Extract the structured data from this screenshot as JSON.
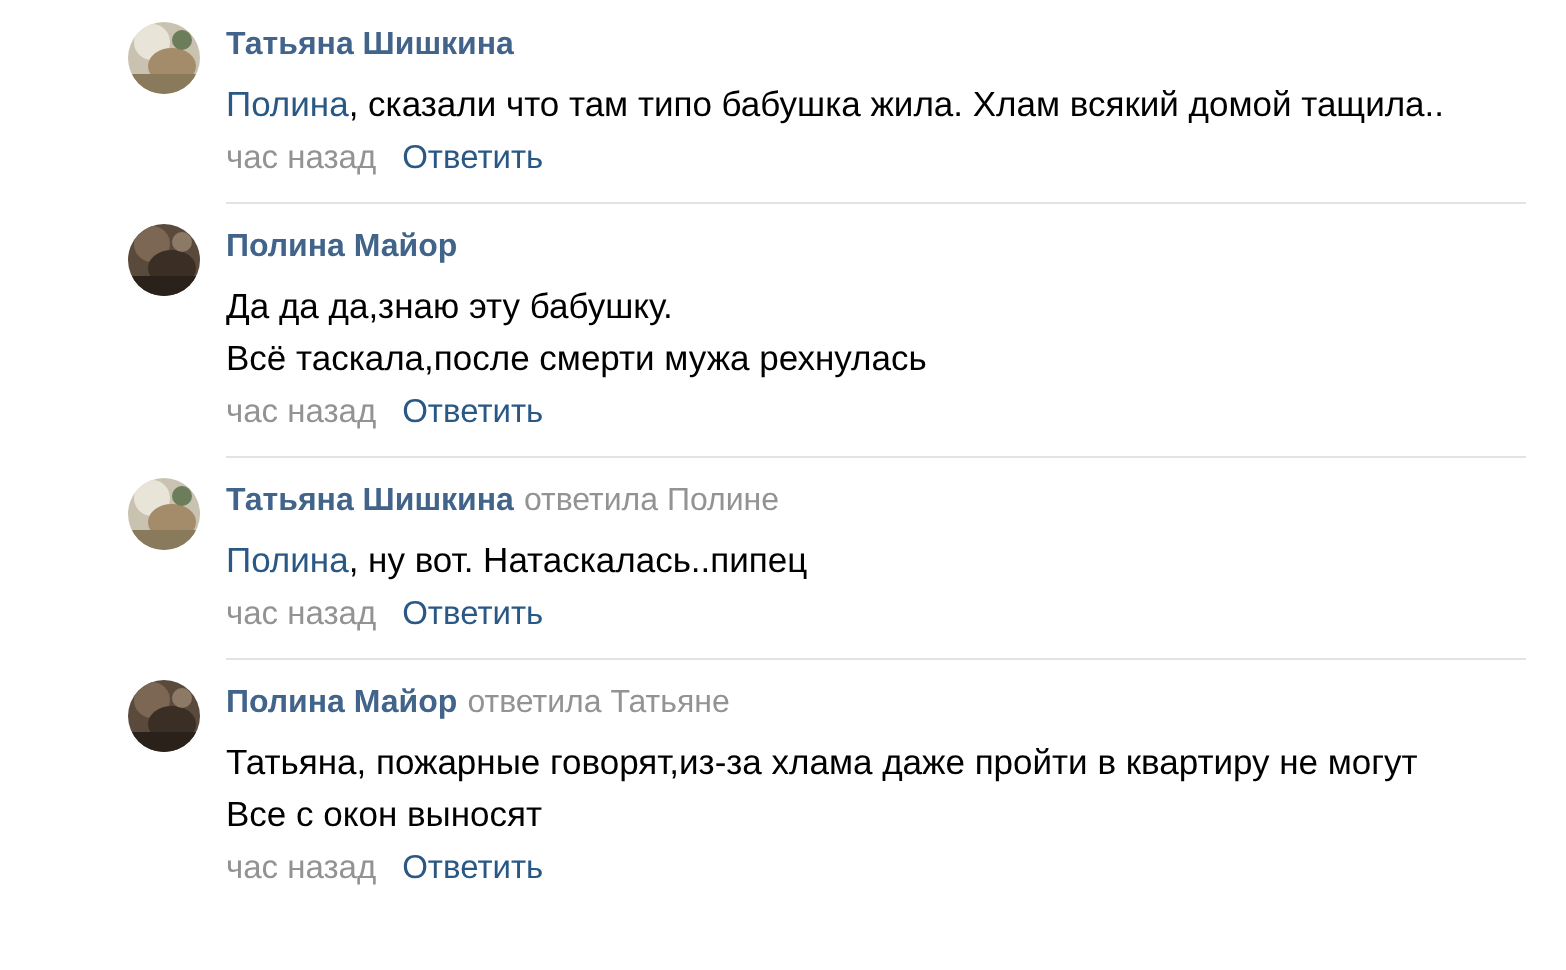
{
  "comments": [
    {
      "author": "Татьяна Шишкина",
      "mention": "Полина",
      "lines": [
        ", сказали что там типо бабушка жила. Хлам всякий домой тащила.."
      ],
      "time": "час назад",
      "reply_label": "Ответить"
    },
    {
      "author": "Полина Майор",
      "lines": [
        "Да да да,знаю эту бабушку.",
        "Всё таскала,после смерти мужа рехнулась"
      ],
      "time": "час назад",
      "reply_label": "Ответить"
    },
    {
      "author": "Татьяна Шишкина",
      "reply_to": "ответила Полине",
      "mention": "Полина",
      "lines": [
        ", ну вот. Натаскалась..пипец"
      ],
      "time": "час назад",
      "reply_label": "Ответить"
    },
    {
      "author": "Полина Майор",
      "reply_to": "ответила Татьяне",
      "lines": [
        "Татьяна, пожарные говорят,из-за хлама даже пройти в квартиру не могут",
        "Все с окон выносят"
      ],
      "time": "час назад",
      "reply_label": "Ответить"
    }
  ]
}
